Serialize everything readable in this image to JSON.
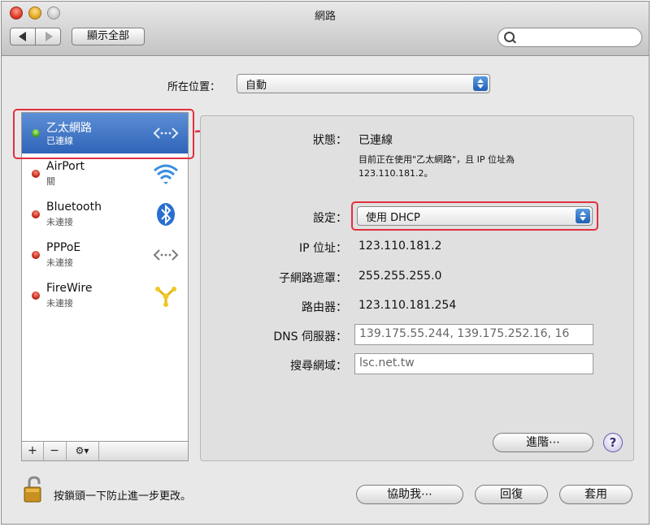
{
  "window": {
    "title": "網路",
    "show_all_label": "顯示全部",
    "search_placeholder": ""
  },
  "location": {
    "label": "所在位置：",
    "value": "自動"
  },
  "services": [
    {
      "name": "乙太網路",
      "status": "已連線",
      "status_color": "#3c9a12",
      "icon": "ethernet-icon",
      "selected": true
    },
    {
      "name": "AirPort",
      "status": "關",
      "status_color": "#b81c0c",
      "icon": "wifi-icon"
    },
    {
      "name": "Bluetooth",
      "status": "未連接",
      "status_color": "#b81c0c",
      "icon": "bluetooth-icon"
    },
    {
      "name": "PPPoE",
      "status": "未連接",
      "status_color": "#b81c0c",
      "icon": "pppoe-icon"
    },
    {
      "name": "FireWire",
      "status": "未連接",
      "status_color": "#b81c0c",
      "icon": "firewire-icon"
    }
  ],
  "list_toolbar": {
    "add": "+",
    "remove": "−",
    "action": "⚙▾"
  },
  "detail": {
    "status_label": "狀態：",
    "status_value": "已連線",
    "status_desc_1": "目前正在使用\"乙太網路\"，且 IP 位址為",
    "status_desc_2": "123.110.181.2。",
    "configure_label": "設定：",
    "configure_value": "使用 DHCP",
    "ip_label": "IP 位址：",
    "ip_value": "123.110.181.2",
    "subnet_label": "子網路遮罩：",
    "subnet_value": "255.255.255.0",
    "router_label": "路由器：",
    "router_value": "123.110.181.254",
    "dns_label": "DNS 伺服器：",
    "dns_value": "139.175.55.244, 139.175.252.16, 16",
    "search_domains_label": "搜尋網域：",
    "search_domains_value": "lsc.net.tw",
    "advanced_label": "進階⋯",
    "help_label": "?"
  },
  "footer": {
    "lock_text": "按鎖頭一下防止進一步更改。",
    "assist_label": "協助我⋯",
    "revert_label": "回復",
    "apply_label": "套用"
  },
  "colors": {
    "selection": "#2f64b8",
    "highlight_box": "#e03040",
    "connected_dot": "#3c9a12",
    "disconnected_dot": "#b81c0c"
  }
}
